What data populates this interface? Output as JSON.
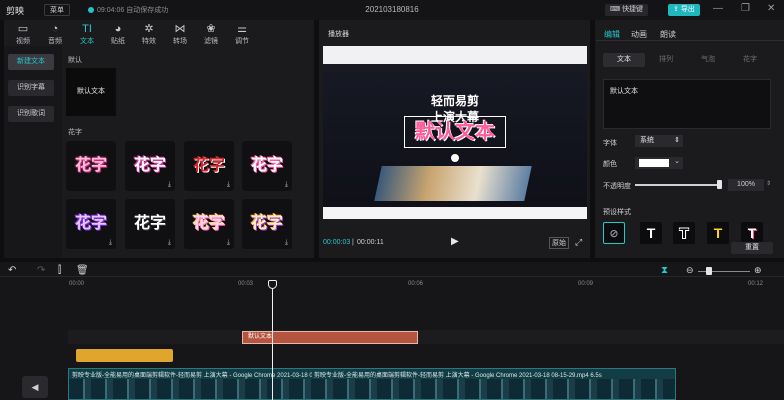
{
  "app": {
    "logo": "剪映",
    "menu_label": "菜单",
    "autosave": "09:04:06 自动保存成功",
    "title": "202103180816",
    "shortcut_label": "快捷键",
    "export_label": "导出",
    "accent": "#1fb6bd"
  },
  "toolbar": {
    "items": [
      {
        "icon": "video-icon",
        "glyph": "▭",
        "label": "视频"
      },
      {
        "icon": "audio-icon",
        "glyph": "◔",
        "label": "音频"
      },
      {
        "icon": "text-icon",
        "glyph": "TI",
        "label": "文本"
      },
      {
        "icon": "sticker-icon",
        "glyph": "◕",
        "label": "贴纸"
      },
      {
        "icon": "effects-icon",
        "glyph": "✲",
        "label": "特效"
      },
      {
        "icon": "transition-icon",
        "glyph": "⋈",
        "label": "转场"
      },
      {
        "icon": "filter-icon",
        "glyph": "❀",
        "label": "滤镜"
      },
      {
        "icon": "adjust-icon",
        "glyph": "⚌",
        "label": "调节"
      }
    ]
  },
  "left_nav": {
    "items": [
      {
        "label": "新建文本"
      },
      {
        "label": "识别字幕"
      },
      {
        "label": "识别歌词"
      }
    ]
  },
  "library": {
    "default_section": "默认",
    "default_tile": "默认文本",
    "flower_section": "花字",
    "flower_text": "花字"
  },
  "player": {
    "title": "播放器",
    "current_time": "00:00:03",
    "total_time": "00:00:11",
    "ratio_label": "原始",
    "video_headline_1": "轻而易剪",
    "video_headline_2": "上演大幕",
    "video_caption": "默认文本"
  },
  "right_panel": {
    "tabs": [
      "编辑",
      "动画",
      "朗读"
    ],
    "subtabs": [
      "文本",
      "排列",
      "气泡",
      "花字"
    ],
    "text_value": "默认文本",
    "font_label": "字体",
    "font_value": "系统",
    "color_label": "颜色",
    "opacity_label": "不透明度",
    "opacity_value": "100%",
    "opacity_level": 1.0,
    "preset_label": "预设样式",
    "reset_label": "重置"
  },
  "timeline": {
    "ticks": [
      "00:00",
      "00:03",
      "00:06",
      "00:09",
      "00:12"
    ],
    "text_clip": "默认文本",
    "video_clip": "剪映专业版-全能易用的桌面端剪辑软件-轻而易剪 上演大幕 - Google Chrome 2021-03-18 0",
    "video_clip_2": "剪映专业版-全能易用的桌面端剪辑软件-轻而易剪 上演大幕 - Google Chrome 2021-03-18 08-15-29.mp4    6.5s"
  }
}
